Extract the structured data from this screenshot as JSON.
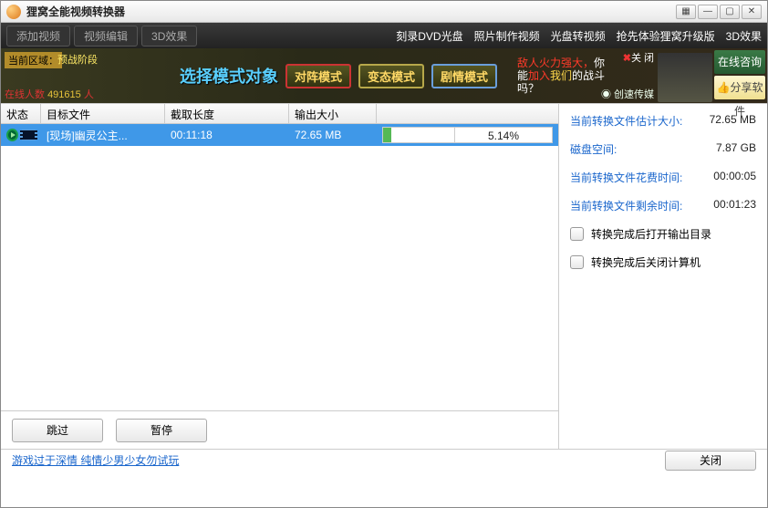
{
  "window": {
    "title": "狸窝全能视频转换器"
  },
  "menubar": {
    "add_video": "添加视频",
    "video_edit": "视频编辑",
    "effect_3d": "3D效果",
    "links": [
      "刻录DVD光盘",
      "照片制作视频",
      "光盘转视频",
      "抢先体验狸窝升级版",
      "3D效果"
    ]
  },
  "adbanner": {
    "zone_label": "当前区域：",
    "stage": "预战阶段",
    "online_label": "在线人数",
    "online_count": "491615",
    "online_suffix": "人",
    "select_mode": "选择模式对象",
    "modes": [
      "对阵模式",
      "变态模式",
      "剧情模式"
    ],
    "promo_l1_a": "敌人火力强大，",
    "promo_l1_b": "你",
    "promo_l2_a": "能",
    "promo_l2_b": "加入",
    "promo_l2_c": "我们",
    "promo_l2_d": "的战斗",
    "promo_l3": "吗？",
    "close_ad": "关 闭",
    "company": "创速传媒",
    "consult": "在线咨询",
    "share": "分享软件"
  },
  "table": {
    "headers": {
      "status": "状态",
      "file": "目标文件",
      "length": "截取长度",
      "size": "输出大小"
    },
    "row": {
      "filename": "[现场]幽灵公主...",
      "length": "00:11:18",
      "size": "72.65 MB",
      "progress_pct": "5.14%",
      "progress_fill": 12
    }
  },
  "info": {
    "est_size_label": "当前转换文件估计大小:",
    "est_size": "72.65 MB",
    "disk_label": "磁盘空间:",
    "disk": "7.87 GB",
    "elapsed_label": "当前转换文件花费时间:",
    "elapsed": "00:00:05",
    "remain_label": "当前转换文件剩余时间:",
    "remain": "00:01:23",
    "open_output": "转换完成后打开输出目录",
    "shutdown": "转换完成后关闭计算机"
  },
  "bottom": {
    "skip": "跳过",
    "pause": "暂停"
  },
  "footer": {
    "link": "游戏过于深情 纯情少男少女勿试玩",
    "close": "关闭"
  }
}
